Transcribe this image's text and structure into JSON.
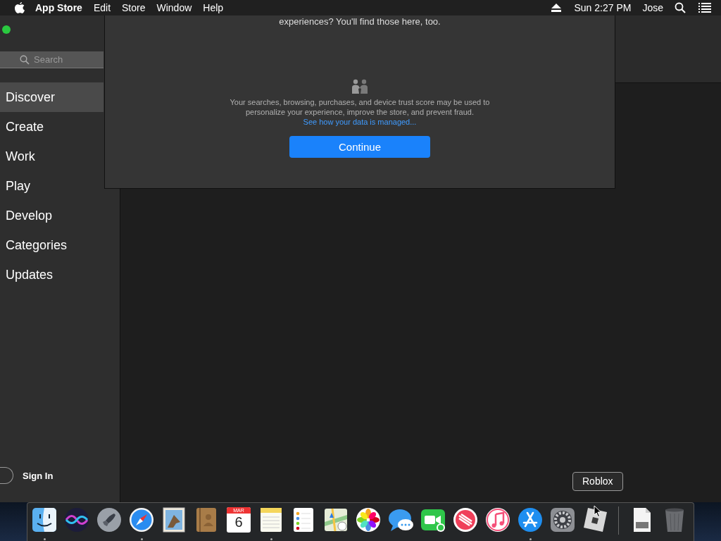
{
  "menu_bar": {
    "app_name": "App Store",
    "menus": [
      "Edit",
      "Store",
      "Window",
      "Help"
    ],
    "clock": "Sun 2:27 PM",
    "user": "Jose"
  },
  "sidebar": {
    "search": {
      "placeholder": "Search"
    },
    "items": [
      {
        "label": "Discover",
        "selected": true
      },
      {
        "label": "Create",
        "selected": false
      },
      {
        "label": "Work",
        "selected": false
      },
      {
        "label": "Play",
        "selected": false
      },
      {
        "label": "Develop",
        "selected": false
      },
      {
        "label": "Categories",
        "selected": false
      },
      {
        "label": "Updates",
        "selected": false
      }
    ],
    "sign_in": "Sign In"
  },
  "dialog": {
    "top_text": "experiences? You'll find those here, too.",
    "privacy_text": "Your searches, browsing, purchases, and device trust score may be used to personalize your experience, improve the store, and prevent fraud.",
    "link": "See how your data is managed...",
    "button": "Continue"
  },
  "dock": {
    "tooltip": "Roblox",
    "items": [
      {
        "kind": "finder",
        "running": true
      },
      {
        "kind": "siri",
        "running": false
      },
      {
        "kind": "rocket",
        "running": false
      },
      {
        "kind": "compass",
        "running": true
      },
      {
        "kind": "stamp",
        "running": false
      },
      {
        "kind": "notebook",
        "running": false
      },
      {
        "kind": "calendar",
        "running": false,
        "month": "MAR",
        "day": "6"
      },
      {
        "kind": "notes",
        "running": true
      },
      {
        "kind": "reminders",
        "running": false
      },
      {
        "kind": "map",
        "running": false
      },
      {
        "kind": "photos",
        "running": false
      },
      {
        "kind": "messages",
        "running": false
      },
      {
        "kind": "facetime",
        "running": false
      },
      {
        "kind": "news",
        "running": false
      },
      {
        "kind": "music",
        "running": false
      },
      {
        "kind": "appstore",
        "running": true
      },
      {
        "kind": "gear",
        "running": false
      },
      {
        "kind": "roblox",
        "running": false
      },
      {
        "kind": "separator"
      },
      {
        "kind": "file",
        "running": false
      },
      {
        "kind": "trash",
        "running": false
      }
    ]
  }
}
